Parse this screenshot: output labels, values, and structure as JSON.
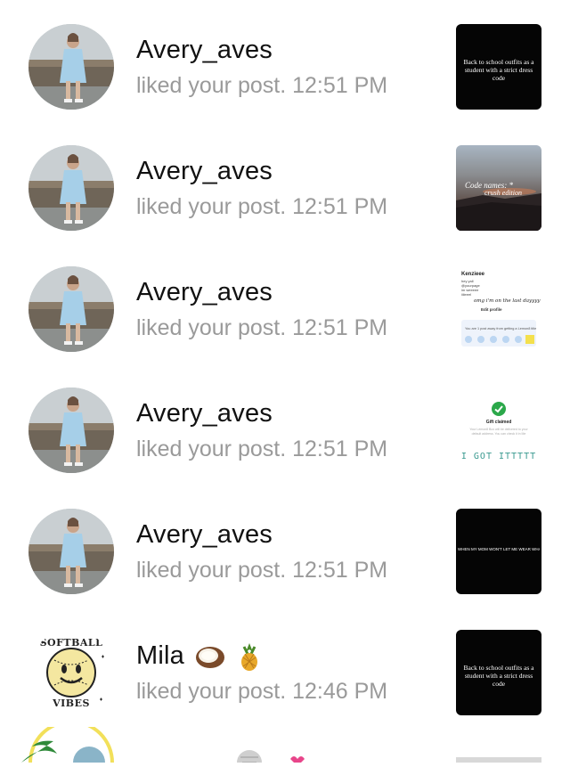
{
  "notifications": [
    {
      "username": "Avery_aves",
      "activity": "liked your post. 12:51 PM",
      "thumb_type": "black-caption",
      "thumb_caption": "Back to school outfits as a student with a strict dress code",
      "avatar": "photo-girl-blue-shirt"
    },
    {
      "username": "Avery_aves",
      "activity": "liked your post. 12:51 PM",
      "thumb_type": "sunset",
      "thumb_caption": "Code names: *",
      "thumb_caption_sub": "crush edition",
      "avatar": "photo-girl-blue-shirt"
    },
    {
      "username": "Avery_aves",
      "activity": "liked your post. 12:51 PM",
      "thumb_type": "profile-screenshot",
      "thumb_name": "Kenzieee",
      "thumb_lines": [
        "hey yall",
        "@yourpage",
        "im weeeee",
        "iiiieeel"
      ],
      "thumb_hand": "omg i'm on the last dayyyy",
      "thumb_edit": "Edit profile",
      "thumb_box": "You are 1 post away from getting a Lemon8 title",
      "avatar": "photo-girl-blue-shirt"
    },
    {
      "username": "Avery_aves",
      "activity": "liked your post. 12:51 PM",
      "thumb_type": "gift",
      "thumb_title": "Gift claimed",
      "thumb_sub": "Your Lemon8 Box will be delivered to your default address. You can check it in Me",
      "thumb_big": "I GOT ITTTTT",
      "avatar": "photo-girl-blue-shirt"
    },
    {
      "username": "Avery_aves",
      "activity": "liked your post. 12:51 PM",
      "thumb_type": "black-small",
      "thumb_caption": "WHEN MY MOM WON'T LET ME WEAR WHAT I WANT",
      "avatar": "photo-girl-blue-shirt"
    },
    {
      "username": "Mila",
      "username_emojis": [
        "coconut",
        "pineapple"
      ],
      "activity": "liked your post. 12:46 PM",
      "thumb_type": "black-caption",
      "thumb_caption": "Back to school outfits as a student with a strict dress code",
      "avatar": "softball-vibes-smiley",
      "avatar_text_top": "SOFTBALL",
      "avatar_text_bottom": "VIBES"
    }
  ],
  "colors": {
    "username": "#111111",
    "activity": "#9a9a9a",
    "background": "#ffffff"
  }
}
